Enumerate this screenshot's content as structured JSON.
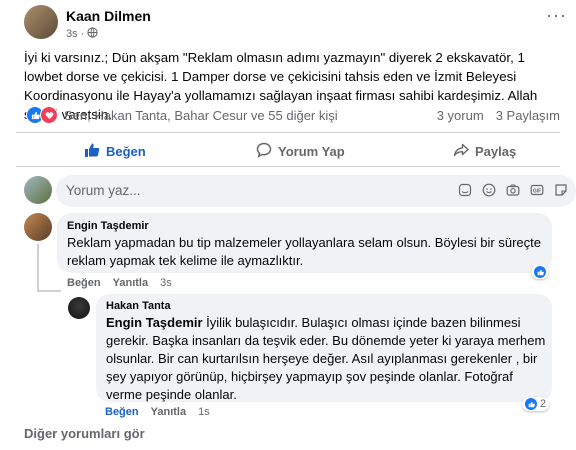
{
  "post": {
    "author": "Kaan Dilmen",
    "time": "3s",
    "more_label": "···",
    "text": "İyi ki varsınız.; Dün akşam \"Reklam olmasın adımı yazmayın\" diyerek 2 ekskavatör, 1 lowbet dorse ve çekicisi. 1 Damper dorse ve çekicisini tahsis eden ve İzmit Beleyesi Koordinasyonu ile Hayay'a yollamamızı sağlayan inşaat firması sahibi kardeşimiz. Allah sizleri varetsin.",
    "reactions_text": "Sen, Hakan Tanta, Bahar Cesur ve 55 diğer kişi",
    "comments_count": "3 yorum",
    "shares_count": "3 Paylaşım"
  },
  "actions": {
    "like": "Beğen",
    "comment": "Yorum Yap",
    "share": "Paylaş"
  },
  "comment_input": {
    "placeholder": "Yorum yaz..."
  },
  "comments": [
    {
      "author": "Engin Taşdemir",
      "text": "Reklam yapmadan bu tip malzemeler yollayanlara selam olsun. Böylesi bir süreçte reklam yapmak tek kelime ile aymazlıktır.",
      "like_label": "Beğen",
      "reply_label": "Yanıtla",
      "time": "3s",
      "reaction_count": ""
    },
    {
      "author": "Hakan Tanta",
      "mention": "Engin Taşdemir",
      "text": " İyilik bulaşıcıdır. Bulaşıcı olması içinde bazen bilinmesi gerekir. Başka insanları da teşvik eder. Bu dönemde yeter ki yaraya merhem olsunlar. Bir can kurtarılsın herşeye değer. Asıl ayıplanması gerekenler , bir şey yapıyor görünüp, hiçbirşey yapmayıp şov peşinde olanlar. Fotoğraf verme peşinde olanlar.",
      "like_label": "Beğen",
      "reply_label": "Yanıtla",
      "time": "1s",
      "reaction_count": "2"
    }
  ],
  "more_comments": "Diğer yorumları gör",
  "colors": {
    "like_blue": "#1877f2",
    "love_red": "#f33e58",
    "bubble_bg": "#f0f2f5",
    "secondary_text": "#65676b"
  }
}
